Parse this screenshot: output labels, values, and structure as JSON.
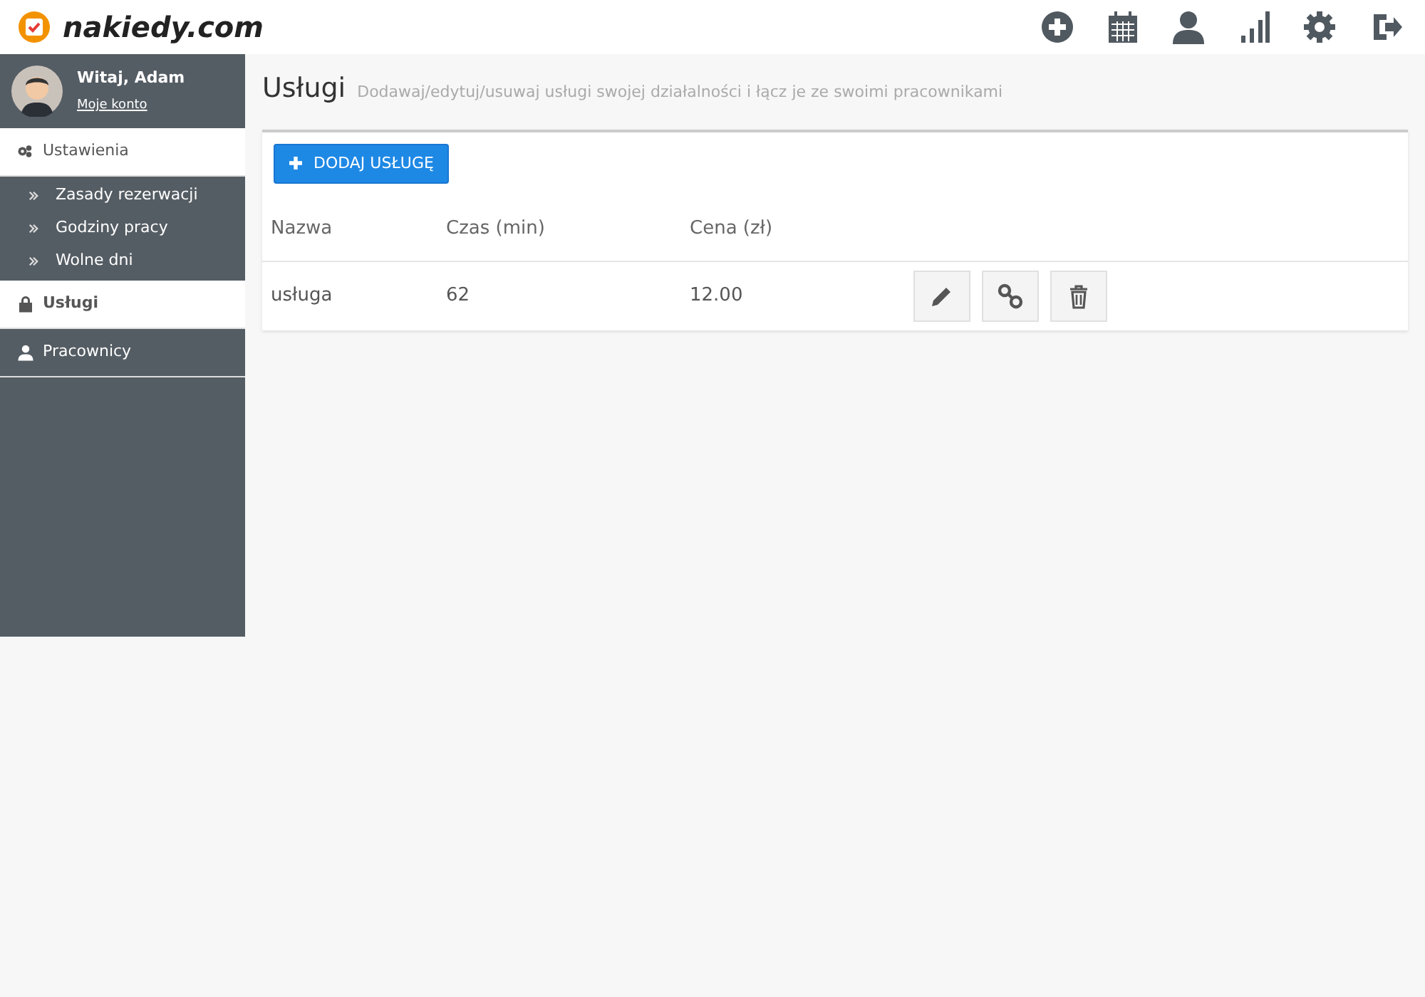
{
  "brand": {
    "name": "nakiedy.com"
  },
  "user": {
    "greeting": "Witaj, Adam",
    "account_link": "Moje konto"
  },
  "sidebar": {
    "items": [
      {
        "label": "Ustawienia",
        "selected": false,
        "expanded": true,
        "children": [
          {
            "label": "Zasady rezerwacji"
          },
          {
            "label": "Godziny pracy"
          },
          {
            "label": "Wolne dni"
          }
        ]
      },
      {
        "label": "Usługi",
        "selected": true,
        "expanded": false
      },
      {
        "label": "Pracownicy",
        "selected": false,
        "expanded": false
      }
    ]
  },
  "page": {
    "title": "Usługi",
    "subtitle": "Dodawaj/edytuj/usuwaj usługi swojej działalności i łącz je ze swoimi pracownikami"
  },
  "add_button": {
    "label": "DODAJ USŁUGĘ"
  },
  "table": {
    "columns": [
      "Nazwa",
      "Czas (min)",
      "Cena (zł)"
    ],
    "rows": [
      {
        "cells": [
          "usługa",
          "62",
          "12.00"
        ]
      }
    ]
  }
}
